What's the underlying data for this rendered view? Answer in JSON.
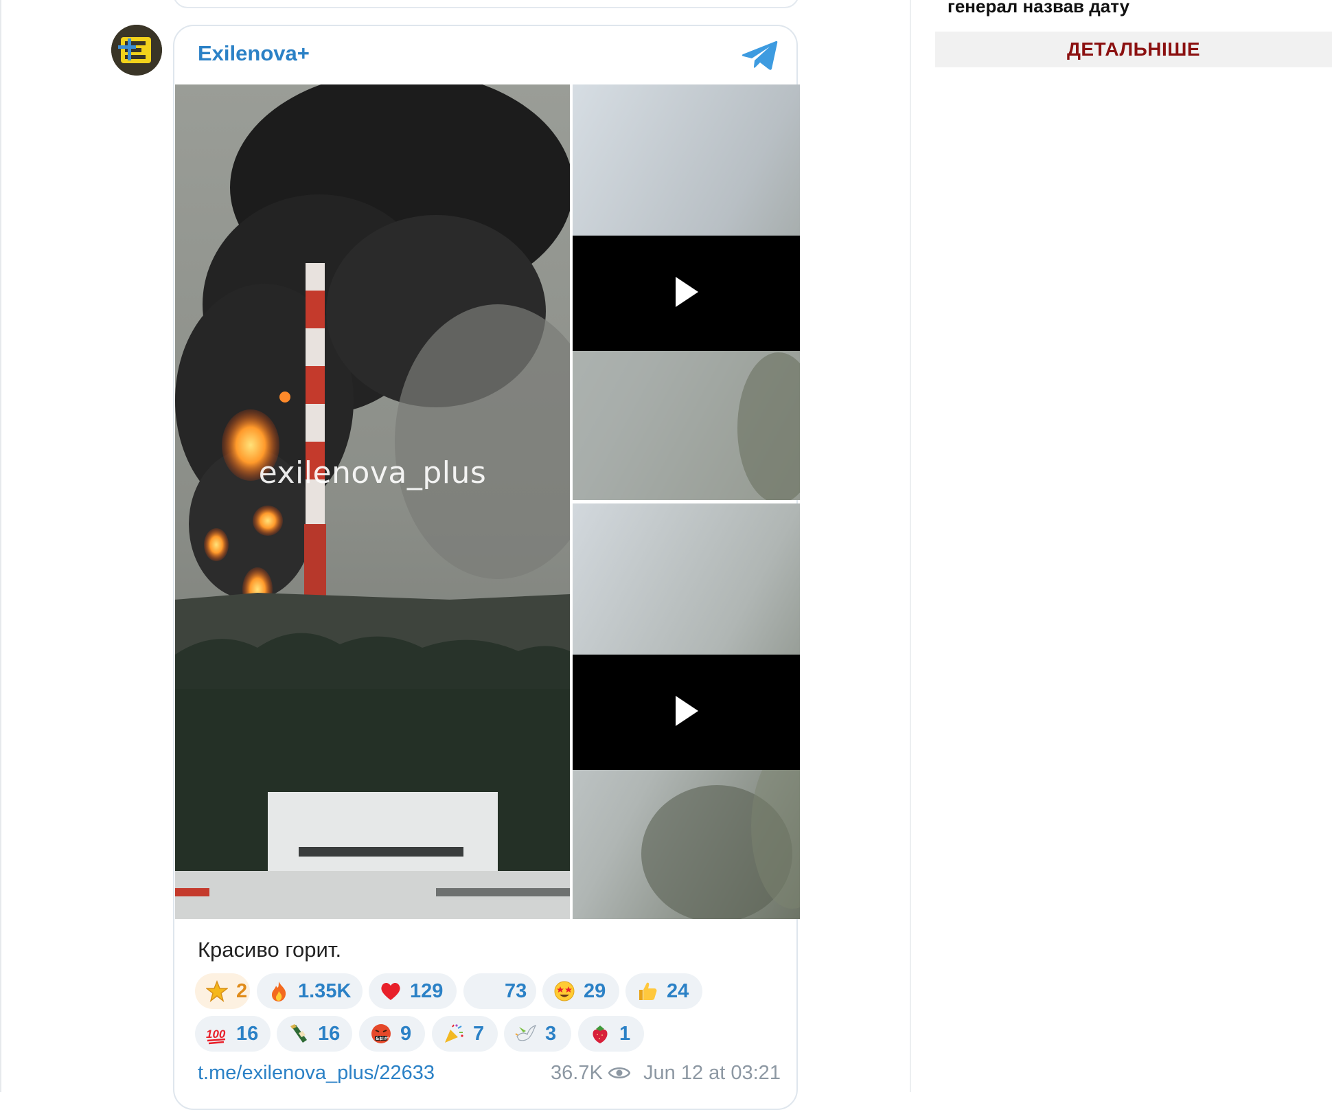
{
  "post": {
    "channel_name": "Exilenova+",
    "watermark": "exilenova_plus",
    "caption": "Красиво горит.",
    "reactions": [
      {
        "icon": "star-icon",
        "count": "2"
      },
      {
        "icon": "fire-icon",
        "count": "1.35K"
      },
      {
        "icon": "heart-icon",
        "count": "129"
      },
      {
        "icon": "blank-icon",
        "count": "73"
      },
      {
        "icon": "star-struck-icon",
        "count": "29"
      },
      {
        "icon": "thumbs-up-icon",
        "count": "24"
      },
      {
        "icon": "hundred-icon",
        "count": "16"
      },
      {
        "icon": "champagne-icon",
        "count": "16"
      },
      {
        "icon": "cursing-face-icon",
        "count": "9"
      },
      {
        "icon": "party-popper-icon",
        "count": "7"
      },
      {
        "icon": "dove-icon",
        "count": "3"
      },
      {
        "icon": "strawberry-icon",
        "count": "1"
      }
    ],
    "link": "t.me/exilenova_plus/22633",
    "views": "36.7K",
    "datetime": "Jun 12 at 03:21"
  },
  "sidebar": {
    "headline": "генерал назвав дату",
    "more_button": "ДЕТАЛЬНІШЕ"
  },
  "colors": {
    "link_blue": "#2b81c6",
    "muted_gray": "#8d98a3",
    "reaction_bg": "#eef2f6",
    "more_button_red": "#8b1010"
  }
}
